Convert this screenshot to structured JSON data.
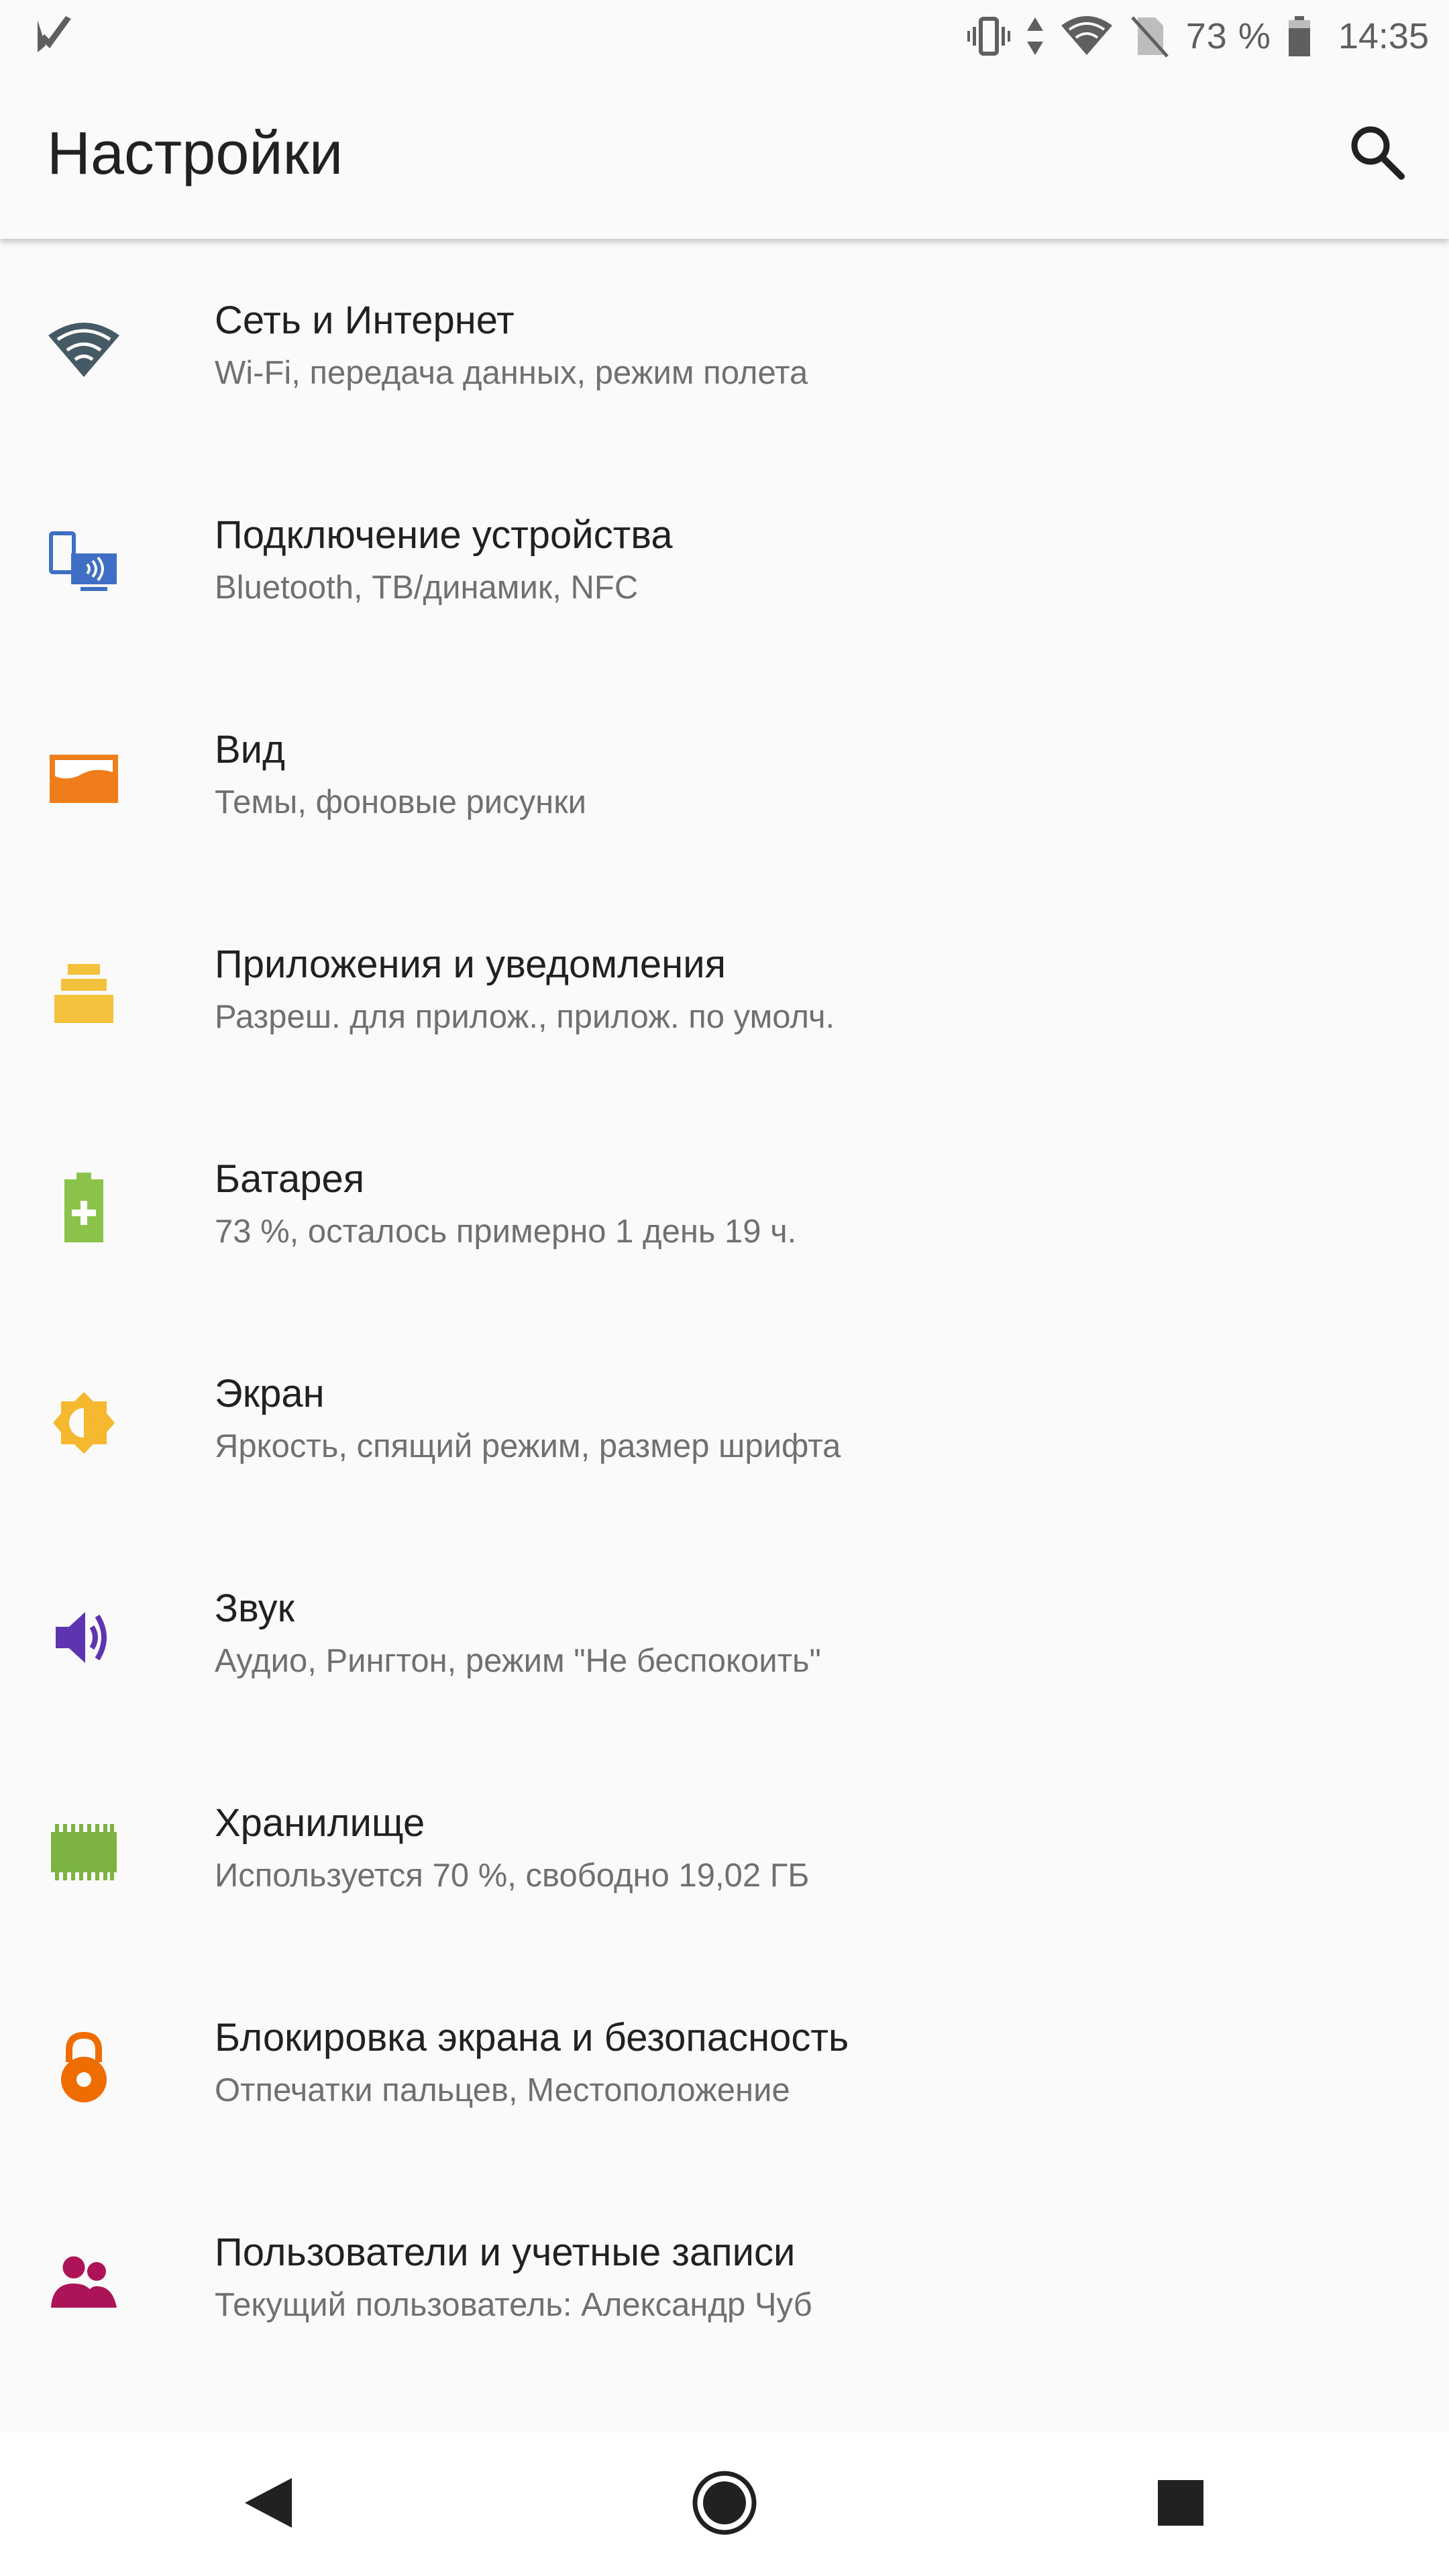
{
  "status_bar": {
    "battery_text": "73 %",
    "time": "14:35",
    "icons": [
      "notification-app-icon",
      "vibrate-icon",
      "data-arrows-icon",
      "wifi-icon",
      "no-sim-icon",
      "battery-icon"
    ]
  },
  "app_bar": {
    "title": "Настройки",
    "search_icon": "search-icon"
  },
  "settings": [
    {
      "id": "network",
      "title": "Сеть и Интернет",
      "subtitle": "Wi-Fi, передача данных, режим полета",
      "icon": "wifi-icon",
      "color": "#455a64"
    },
    {
      "id": "devices",
      "title": "Подключение устройства",
      "subtitle": "Bluetooth, ТВ/динамик, NFC",
      "icon": "connected-devices-icon",
      "color": "#3f6fc4"
    },
    {
      "id": "display-style",
      "title": "Вид",
      "subtitle": "Темы, фоновые рисунки",
      "icon": "wallpaper-icon",
      "color": "#ef7d1a"
    },
    {
      "id": "apps",
      "title": "Приложения и уведомления",
      "subtitle": "Разреш. для прилож., прилож. по умолч.",
      "icon": "apps-stack-icon",
      "color": "#f4c13c"
    },
    {
      "id": "battery",
      "title": "Батарея",
      "subtitle": "73 %, осталось примерно 1 день 19 ч.",
      "icon": "battery-plus-icon",
      "color": "#8bc34a"
    },
    {
      "id": "screen",
      "title": "Экран",
      "subtitle": "Яркость, спящий режим, размер шрифта",
      "icon": "brightness-icon",
      "color": "#f5b82e"
    },
    {
      "id": "sound",
      "title": "Звук",
      "subtitle": "Аудио, Рингтон, режим \"Не беспокоить\"",
      "icon": "speaker-icon",
      "color": "#5e35b1"
    },
    {
      "id": "storage",
      "title": "Хранилище",
      "subtitle": "Используется 70 %, свободно 19,02 ГБ",
      "icon": "memory-chip-icon",
      "color": "#7cb342"
    },
    {
      "id": "security",
      "title": "Блокировка экрана и безопасность",
      "subtitle": "Отпечатки пальцев, Местоположение",
      "icon": "lock-icon",
      "color": "#ef6c00"
    },
    {
      "id": "users",
      "title": "Пользователи и учетные записи",
      "subtitle": "Текущий пользователь: Александр Чуб",
      "icon": "users-icon",
      "color": "#ad1457"
    }
  ],
  "nav_bar": {
    "buttons": [
      "back-icon",
      "home-icon",
      "recents-icon"
    ]
  }
}
